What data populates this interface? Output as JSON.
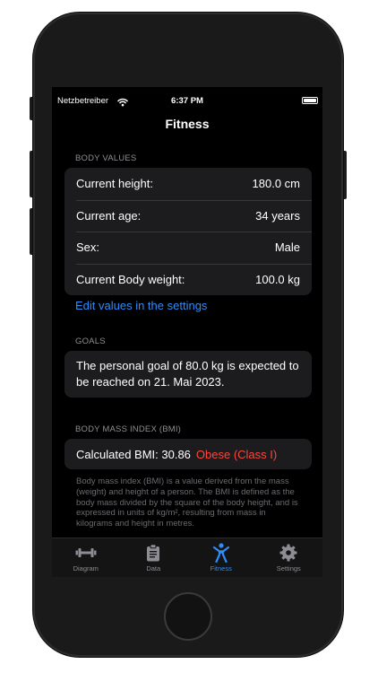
{
  "status_bar": {
    "carrier": "Netzbetreiber",
    "time": "6:37 PM"
  },
  "nav": {
    "title": "Fitness"
  },
  "body_values": {
    "header": "BODY VALUES",
    "rows": [
      {
        "label": "Current height:",
        "value": "180.0 cm"
      },
      {
        "label": "Current age:",
        "value": "34 years"
      },
      {
        "label": "Sex:",
        "value": "Male"
      },
      {
        "label": "Current Body weight:",
        "value": "100.0 kg"
      }
    ],
    "edit_link": "Edit values in the settings"
  },
  "goals": {
    "header": "GOALS",
    "text": "The personal goal of 80.0 kg is expected to be reached on 21. Mai 2023."
  },
  "bmi": {
    "header": "BODY MASS INDEX (BMI)",
    "label": "Calculated BMI: 30.86",
    "status": "Obese (Class I)",
    "description": "Body mass index (BMI) is a value derived from the mass (weight) and height of a person. The BMI is defined as the body mass divided by the square of the body height, and is expressed in units of kg/m², resulting from mass in kilograms and height in metres."
  },
  "tabs": [
    {
      "label": "Diagram",
      "icon": "dumbbell-icon"
    },
    {
      "label": "Data",
      "icon": "clipboard-icon"
    },
    {
      "label": "Fitness",
      "icon": "figure-icon"
    },
    {
      "label": "Settings",
      "icon": "gear-icon"
    }
  ],
  "colors": {
    "accent": "#2f8cf7",
    "danger": "#ff453a",
    "background": "#000000",
    "card": "#1c1c1e",
    "secondary_text": "#8d8d93"
  }
}
